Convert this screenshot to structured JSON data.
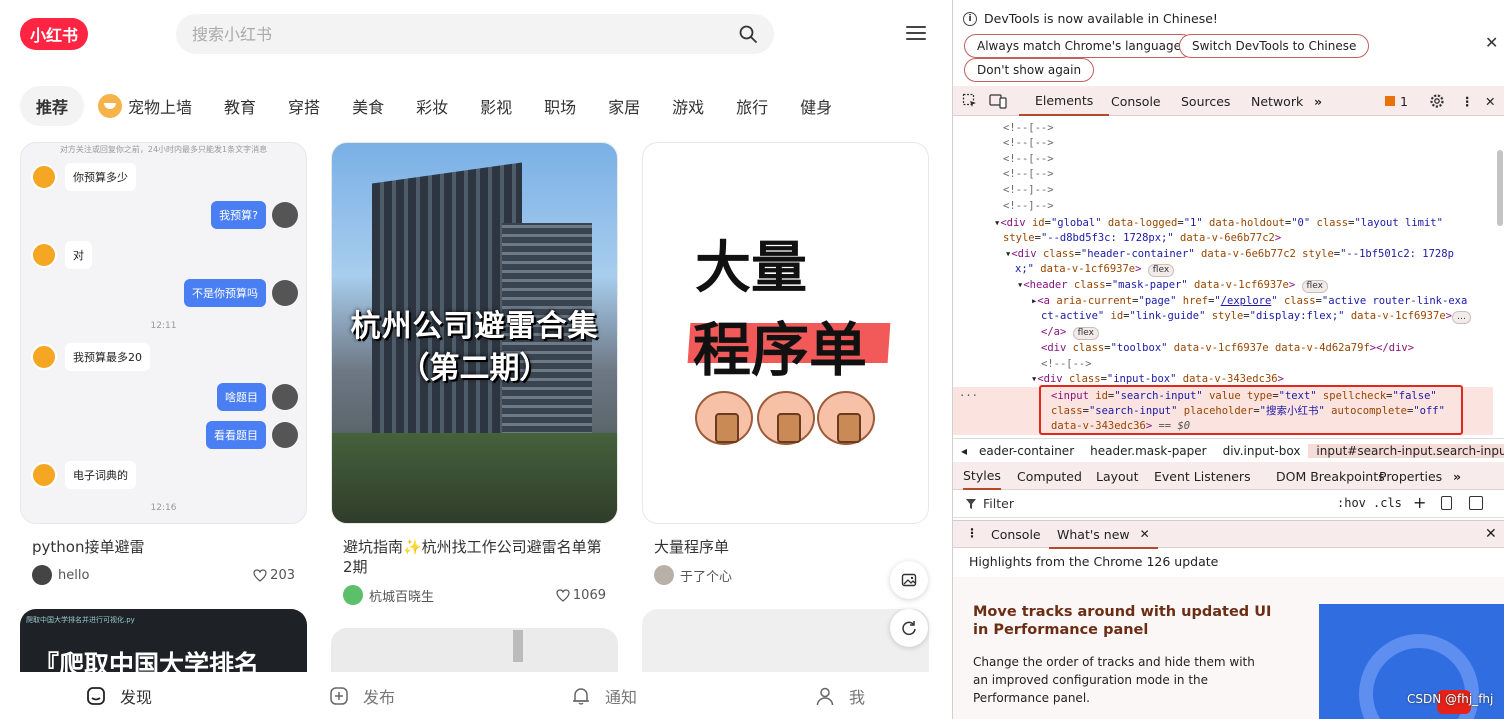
{
  "xhs": {
    "logo": "小红书",
    "search_placeholder": "搜索小红书",
    "channels": [
      "推荐",
      "宠物上墙",
      "教育",
      "穿搭",
      "美食",
      "彩妆",
      "影视",
      "职场",
      "家居",
      "游戏",
      "旅行",
      "健身"
    ],
    "cards": [
      {
        "title": "python接单避雷",
        "author": "hello",
        "likes": "203",
        "cover": {
          "top_note": "对方关注或回复你之前，24小时内最多只能发1条文字消息",
          "messages": [
            {
              "side": "left",
              "text": "你预算多少"
            },
            {
              "side": "right",
              "text": "我预算?"
            },
            {
              "side": "left",
              "text": "对"
            },
            {
              "side": "right",
              "text": "不是你预算吗"
            },
            {
              "side": "time",
              "text": "12:11"
            },
            {
              "side": "left",
              "text": "我预算最多20"
            },
            {
              "side": "right",
              "text": "啥题目"
            },
            {
              "side": "right",
              "text": "看看题目"
            },
            {
              "side": "left",
              "text": "电子词典的"
            },
            {
              "side": "time",
              "text": "12:16"
            }
          ]
        }
      },
      {
        "title": "避坑指南✨杭州找工作公司避雷名单第2期",
        "author": "杭城百晓生",
        "likes": "1069",
        "cover": {
          "line1": "杭州公司避雷合集",
          "line2": "（第二期）"
        }
      },
      {
        "title": "大量程序单",
        "author": "于了个心",
        "likes": "",
        "cover": {
          "line1": "大量",
          "line2": "程序单"
        }
      }
    ],
    "partial_card_text": "『爬取中国大学排名",
    "partial_card_code": "爬取中国大学排名并进行可视化.py",
    "bottom_nav": {
      "discover": "发现",
      "publish": "发布",
      "notify": "通知",
      "me": "我"
    }
  },
  "devtools": {
    "info_message": "DevTools is now available in Chinese!",
    "info_buttons": [
      "Always match Chrome's language",
      "Switch DevTools to Chinese",
      "Don't show again"
    ],
    "main_tabs": [
      "Elements",
      "Console",
      "Sources",
      "Network"
    ],
    "issues_count": "1",
    "dom_lines": [
      "<!--[-->",
      "<!--[-->",
      "<!--[-->",
      "<!--[-->",
      "<!--]-->",
      "<!--]-->"
    ],
    "breadcrumbs": [
      "eader-container",
      "header.mask-paper",
      "div.input-box",
      "input#search-input.search-input"
    ],
    "styles_tabs": [
      "Styles",
      "Computed",
      "Layout",
      "Event Listeners",
      "DOM Breakpoints",
      "Properties"
    ],
    "filter_placeholder": "Filter",
    "filter_tools": [
      ":hov",
      ".cls"
    ],
    "drawer_tabs": [
      "Console",
      "What's new"
    ],
    "highlights": "Highlights from the Chrome 126 update",
    "whatsnew_title": "Move tracks around with updated UI in Performance panel",
    "whatsnew_body": "Change the order of tracks and hide them with an improved configuration mode in the Performance panel.",
    "watermark": "CSDN @fhj_fhj"
  },
  "colors": {
    "brand": "#ff2442",
    "accent": "#b34a2a",
    "chat_blue": "#4a7ef3"
  }
}
